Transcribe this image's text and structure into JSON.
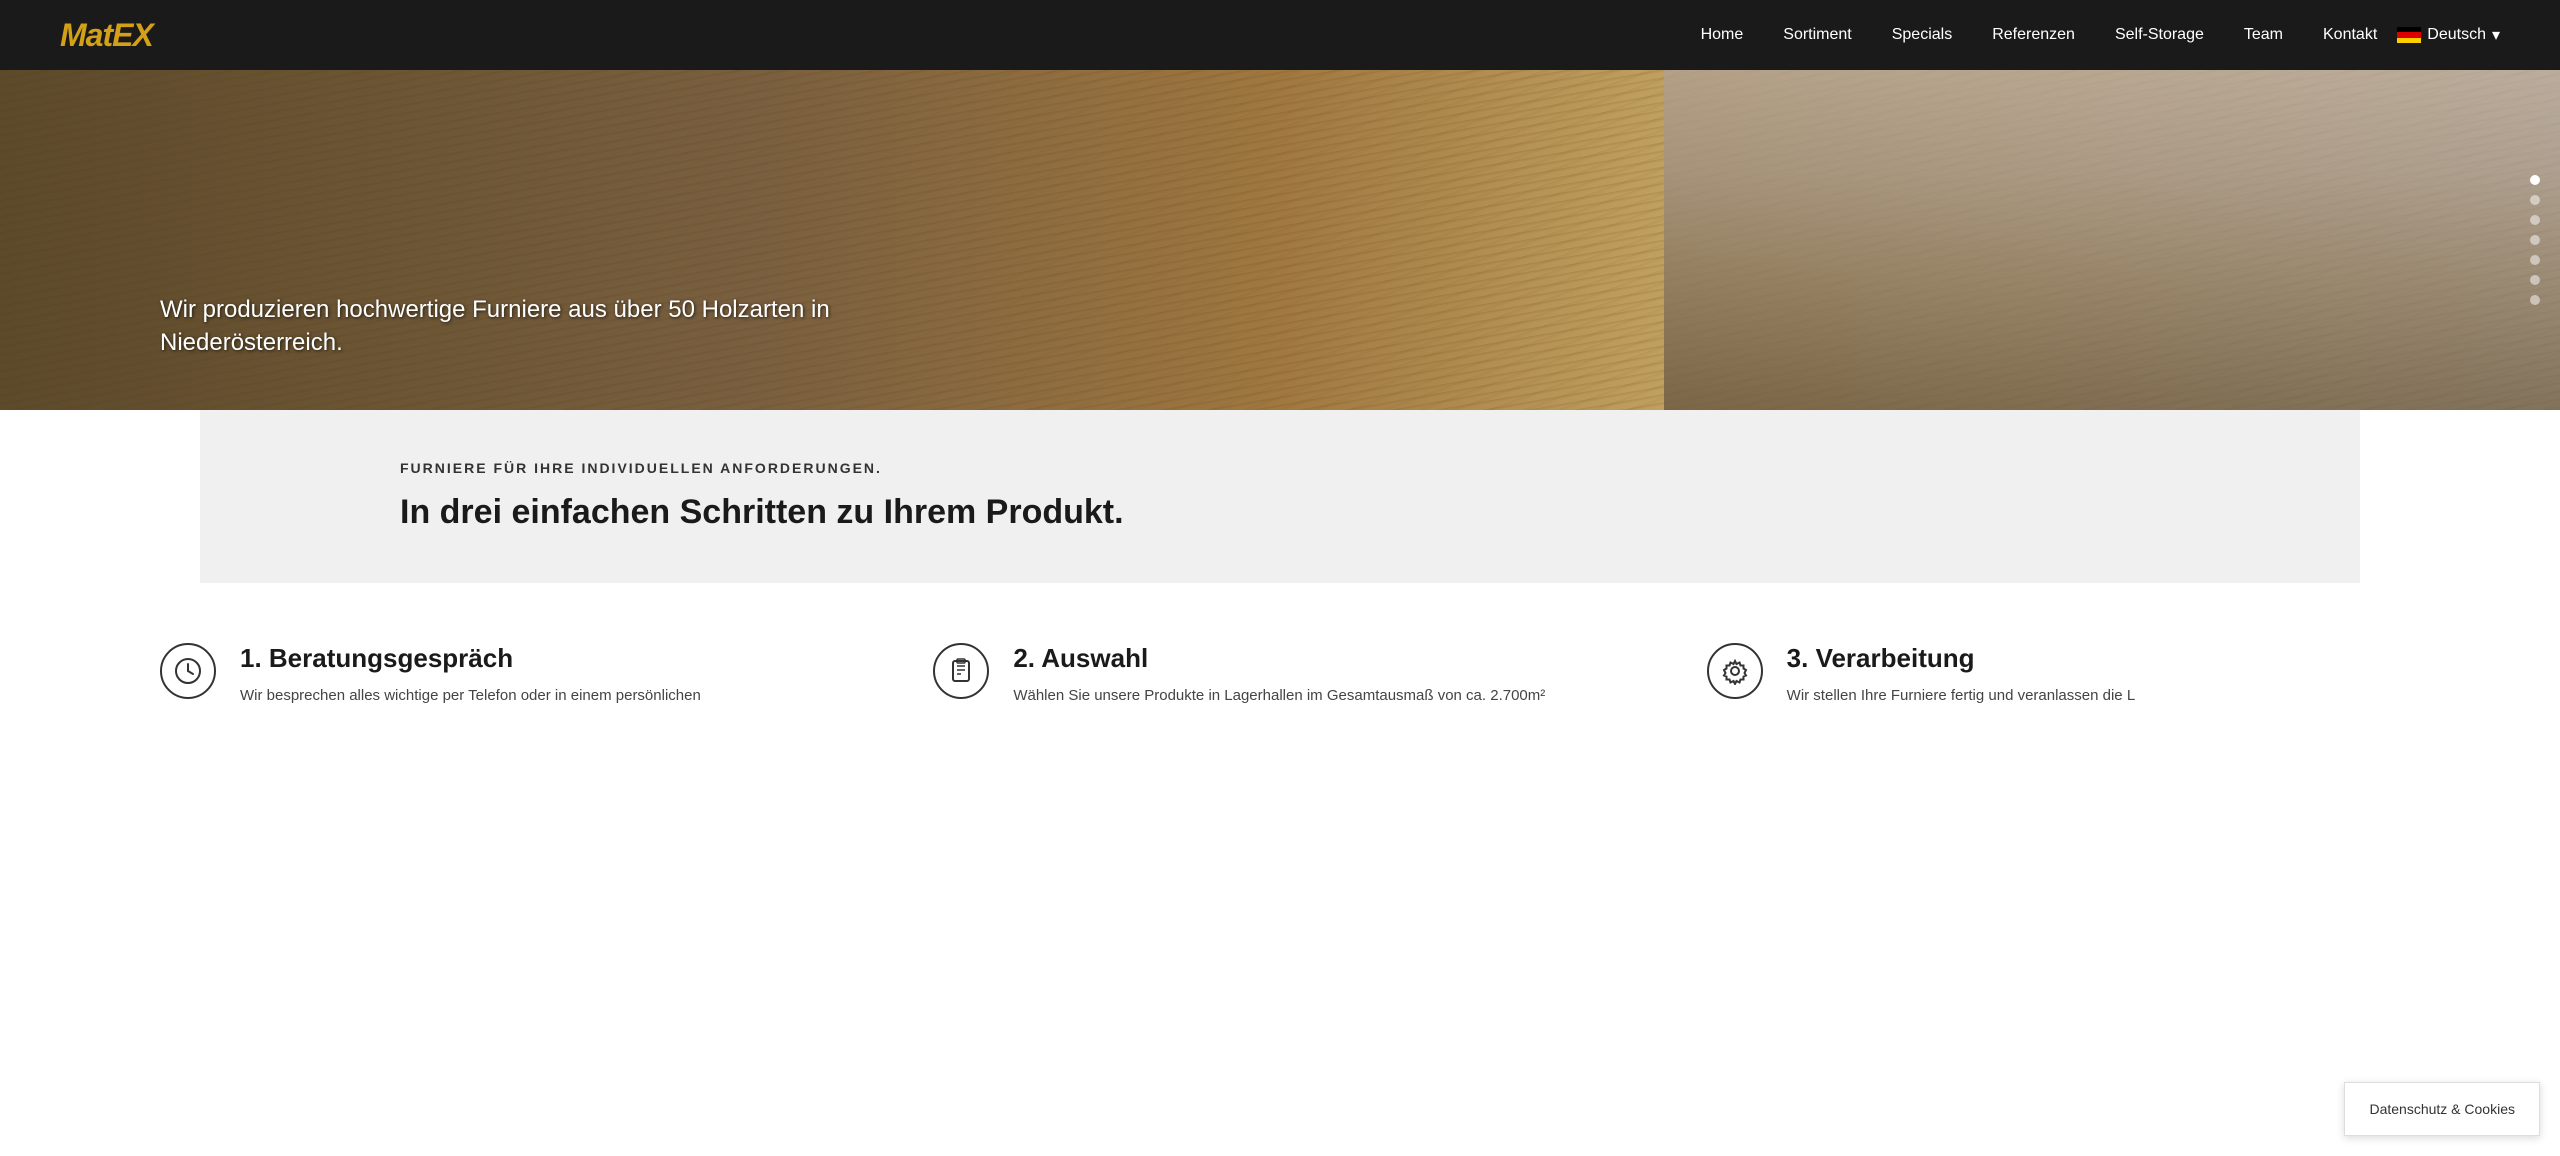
{
  "navbar": {
    "logo_part1": "Mat",
    "logo_part2": "EX",
    "links": [
      {
        "label": "Home",
        "href": "#"
      },
      {
        "label": "Sortiment",
        "href": "#"
      },
      {
        "label": "Specials",
        "href": "#"
      },
      {
        "label": "Referenzen",
        "href": "#"
      },
      {
        "label": "Self-Storage",
        "href": "#"
      },
      {
        "label": "Team",
        "href": "#"
      },
      {
        "label": "Kontakt",
        "href": "#"
      }
    ],
    "lang_label": "Deutsch",
    "lang_dropdown_icon": "▾"
  },
  "hero": {
    "text": "Wir produzieren hochwertige Furniere aus über 50 Holzarten in Niederösterreich.",
    "slides_count": 7,
    "active_slide": 0
  },
  "steps_intro": {
    "subtitle": "FURNIERE FÜR IHRE INDIVIDUELLEN ANFORDERUNGEN.",
    "title": "In drei einfachen Schritten zu Ihrem Produkt."
  },
  "steps": [
    {
      "icon": "🕐",
      "icon_name": "clock-icon",
      "number_title": "1. Beratungsgespräch",
      "desc": "Wir besprechen alles wichtige per Telefon oder in einem persönlichen"
    },
    {
      "icon": "📋",
      "icon_name": "clipboard-icon",
      "number_title": "2. Auswahl",
      "desc": "Wählen Sie unsere Produkte in Lagerhallen im Gesamtausmaß von ca. 2.700m²"
    },
    {
      "icon": "⚙",
      "icon_name": "gear-icon",
      "number_title": "3. Verarbeitung",
      "desc": "Wir stellen Ihre Furniere fertig und veranlassen die L"
    }
  ],
  "cookie_banner": {
    "label": "Datenschutz & Cookies"
  }
}
